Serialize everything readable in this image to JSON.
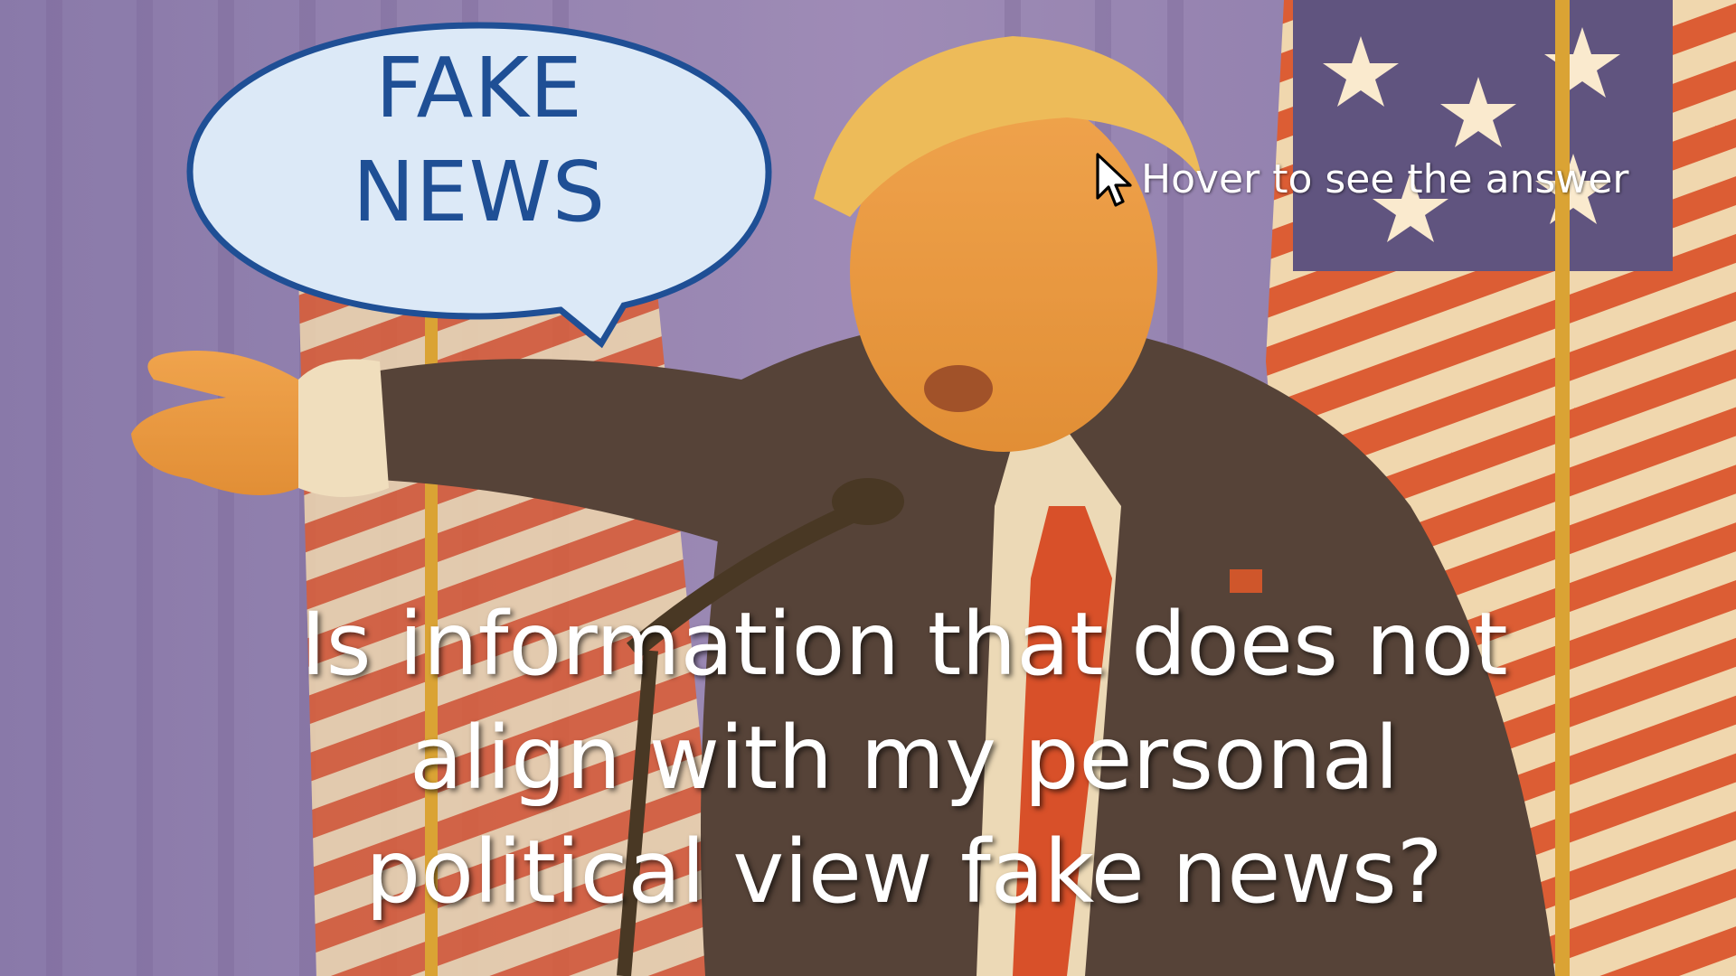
{
  "bubble": {
    "line1": "FAKE",
    "line2": "NEWS",
    "text_color": "#1f4f95",
    "fill_color": "#dce9f7",
    "border_color": "#1f4f95"
  },
  "hover_hint": {
    "label": "Hover to see the answer",
    "icon": "mouse-pointer-icon"
  },
  "question": {
    "line1": "Is information that does not",
    "line2": "align with my personal",
    "line3": "political view fake news?"
  },
  "image": {
    "subject": "speaker-pointing-at-podium",
    "tint_color": "#e6a01e"
  }
}
